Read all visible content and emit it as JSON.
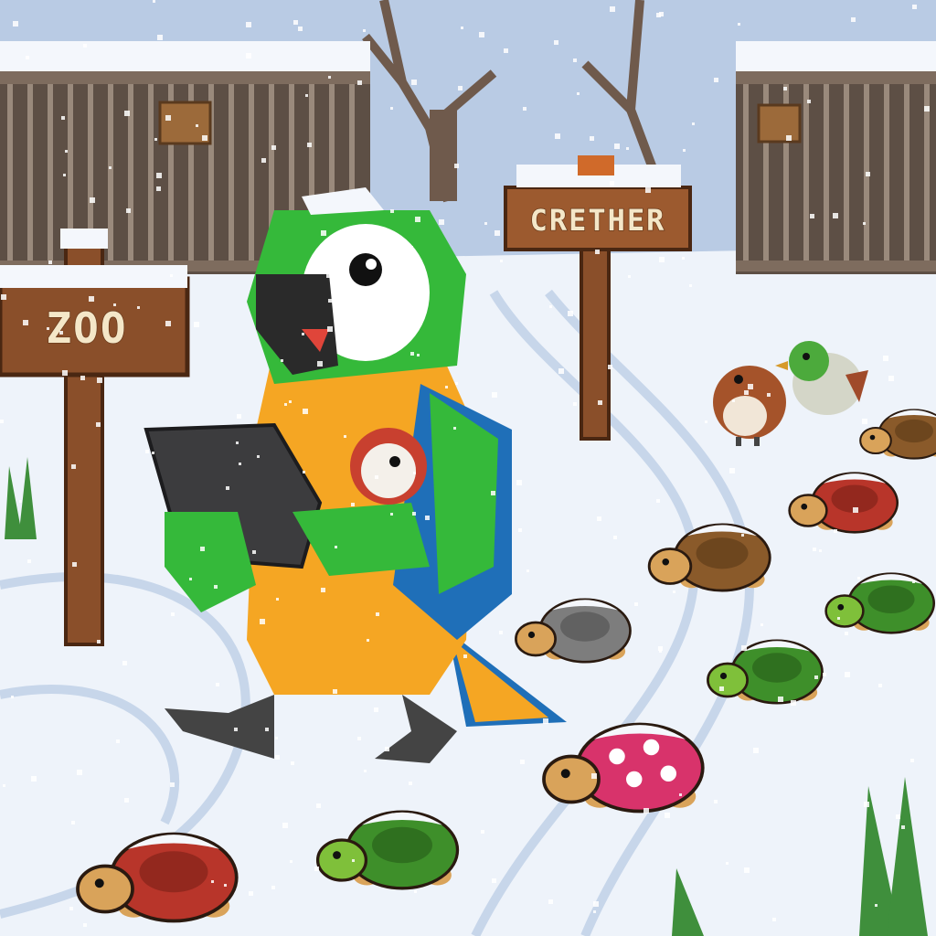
{
  "signs": {
    "zoo": "ZOO",
    "cage": "CRETHER"
  },
  "colors": {
    "sky": "#c9d8ec",
    "snow": "#f2f6fc",
    "wood": "#8a4f2a",
    "wood_dark": "#5a3018",
    "cage": "#6b5a4d",
    "parrot_green": "#35b93a",
    "parrot_yellow": "#f5a623",
    "parrot_blue": "#1f6fb8",
    "tablet": "#3c3c3e"
  },
  "characters": [
    {
      "kind": "macaw",
      "holding": "tablet"
    },
    {
      "kind": "robin"
    },
    {
      "kind": "duckling"
    },
    {
      "kind": "turtle",
      "shell": "red"
    },
    {
      "kind": "turtle",
      "shell": "green"
    },
    {
      "kind": "turtle",
      "shell": "gray"
    },
    {
      "kind": "turtle",
      "shell": "pink-spotted"
    },
    {
      "kind": "turtle",
      "shell": "brown"
    }
  ]
}
